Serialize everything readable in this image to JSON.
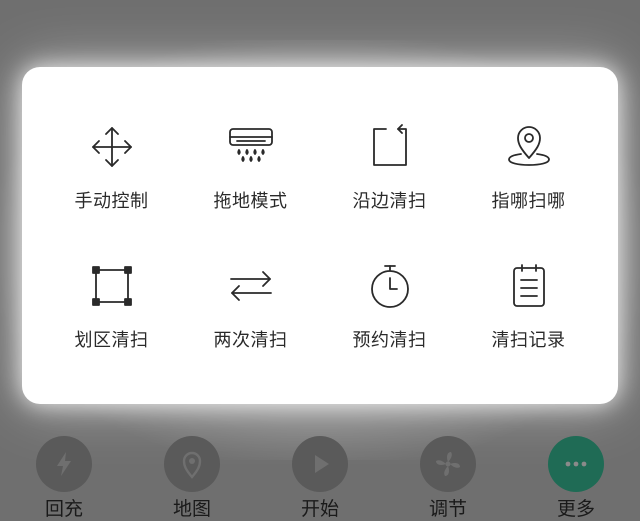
{
  "menu": {
    "items": [
      {
        "label": "手动控制",
        "icon": "move-arrows-icon"
      },
      {
        "label": "拖地模式",
        "icon": "mop-icon"
      },
      {
        "label": "沿边清扫",
        "icon": "edge-clean-icon"
      },
      {
        "label": "指哪扫哪",
        "icon": "location-pin-icon"
      },
      {
        "label": "划区清扫",
        "icon": "area-select-icon"
      },
      {
        "label": "两次清扫",
        "icon": "repeat-arrows-icon"
      },
      {
        "label": "预约清扫",
        "icon": "timer-icon"
      },
      {
        "label": "清扫记录",
        "icon": "clipboard-icon"
      }
    ]
  },
  "bottom_nav": {
    "items": [
      {
        "label": "回充",
        "icon": "charge-bolt-icon"
      },
      {
        "label": "地图",
        "icon": "map-pin-icon"
      },
      {
        "label": "开始",
        "icon": "play-icon"
      },
      {
        "label": "调节",
        "icon": "fan-icon"
      },
      {
        "label": "更多",
        "icon": "more-dots-icon",
        "active": true
      }
    ]
  },
  "colors": {
    "overlay": "#6f6f6f",
    "panel": "#ffffff",
    "icon_stroke": "#2a2a2a",
    "accent": "#1f6b55",
    "inactive_circle": "#5a5a5a"
  }
}
